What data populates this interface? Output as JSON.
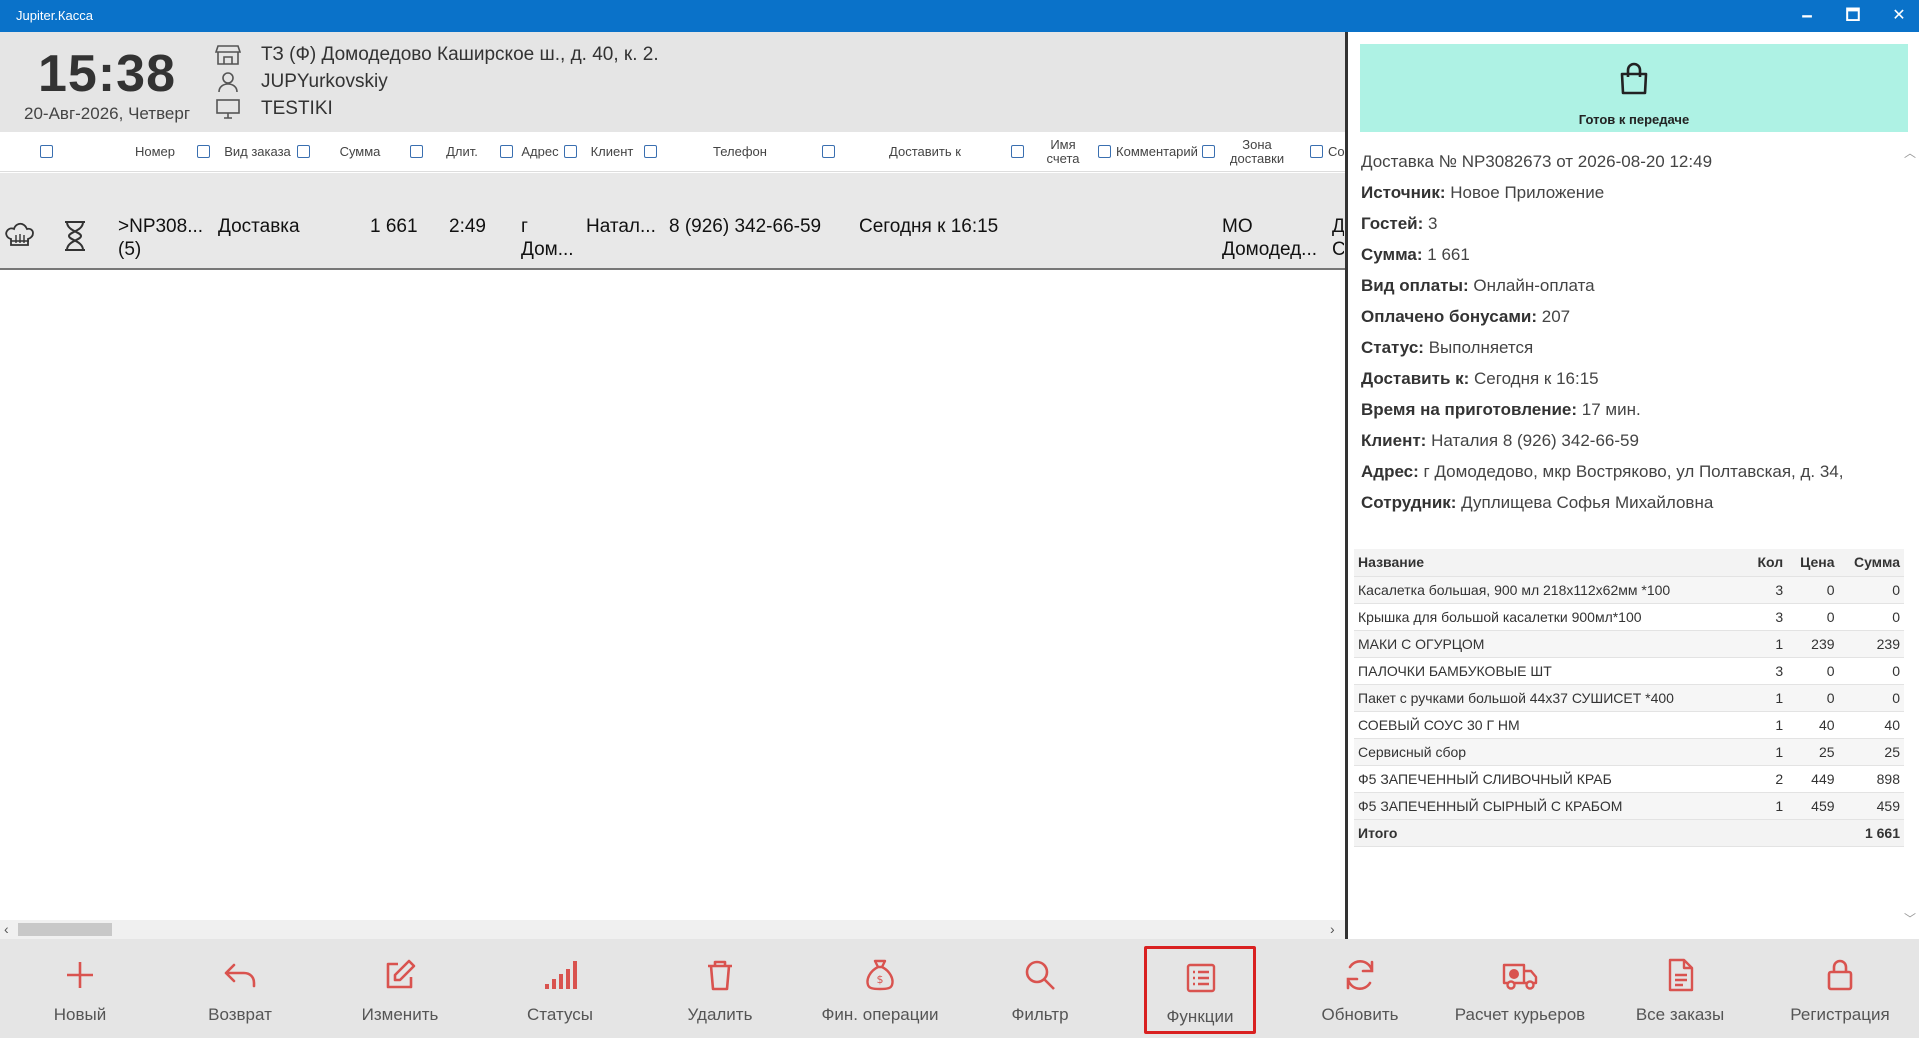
{
  "window": {
    "title": "Jupiter.Касса",
    "min": "🗕",
    "max": "🗖",
    "close": "✕"
  },
  "header": {
    "time": "15:38",
    "date": "20-Авг-2026, Четверг",
    "store": "ТЗ (Ф) Домодедово Каширское ш., д. 40, к. 2.",
    "user": "JUPYurkovskiy",
    "terminal": "TESTIKI"
  },
  "columns": [
    "Номер",
    "Вид заказа",
    "Сумма",
    "Длит.",
    "Адрес",
    "Клиент",
    "Телефон",
    "Доставить к",
    "Имя счета",
    "Комментарий",
    "Зона доставки",
    "Со"
  ],
  "orders": [
    {
      "number": ">NP308... (5)",
      "type": "Доставка",
      "sum": "1 661",
      "duration": "2:49",
      "address": "г Дом...",
      "client": "Натал...",
      "phone": "8 (926) 342-66-59",
      "deliver_by": "Сегодня к 16:15",
      "zone": "МО Домодед...",
      "extra": "Д С"
    }
  ],
  "detail": {
    "status_button": "Готов к передаче",
    "title": "Доставка № NP3082673 от 2026-08-20 12:49",
    "fields": [
      {
        "label": "Источник:",
        "value": "Новое Приложение"
      },
      {
        "label": "Гостей:",
        "value": "3"
      },
      {
        "label": "Сумма:",
        "value": "1 661"
      },
      {
        "label": "Вид оплаты:",
        "value": "Онлайн-оплата"
      },
      {
        "label": "Оплачено бонусами:",
        "value": "207"
      },
      {
        "label": "Статус:",
        "value": "Выполняется"
      },
      {
        "label": "Доставить к:",
        "value": "Сегодня к 16:15"
      },
      {
        "label": "Время на приготовление:",
        "value": "17 мин."
      },
      {
        "label": "Клиент:",
        "value": "Наталия 8 (926) 342-66-59"
      },
      {
        "label": "Адрес:",
        "value": "г Домодедово, мкр Востряково, ул Полтавская, д. 34,"
      },
      {
        "label": "Сотрудник:",
        "value": "Дуплищева Софья Михайловна"
      }
    ],
    "table_headers": [
      "Название",
      "Кол",
      "Цена",
      "Сумма"
    ],
    "items": [
      {
        "name": "Касалетка большая, 900 мл 218х112х62мм *100",
        "qty": "3",
        "price": "0",
        "sum": "0"
      },
      {
        "name": "Крышка для большой касалетки 900мл*100",
        "qty": "3",
        "price": "0",
        "sum": "0"
      },
      {
        "name": "МАКИ С ОГУРЦОМ",
        "qty": "1",
        "price": "239",
        "sum": "239"
      },
      {
        "name": "ПАЛОЧКИ БАМБУКОВЫЕ ШТ",
        "qty": "3",
        "price": "0",
        "sum": "0"
      },
      {
        "name": "Пакет с ручками большой 44х37 СУШИСЕТ *400",
        "qty": "1",
        "price": "0",
        "sum": "0"
      },
      {
        "name": "СОЕВЫЙ СОУС 30 Г НМ",
        "qty": "1",
        "price": "40",
        "sum": "40"
      },
      {
        "name": "Сервисный сбор",
        "qty": "1",
        "price": "25",
        "sum": "25"
      },
      {
        "name": "Ф5 ЗАПЕЧЕННЫЙ СЛИВОЧНЫЙ КРАБ",
        "qty": "2",
        "price": "449",
        "sum": "898"
      },
      {
        "name": "Ф5 ЗАПЕЧЕННЫЙ СЫРНЫЙ С КРАБОМ",
        "qty": "1",
        "price": "459",
        "sum": "459"
      }
    ],
    "total_label": "Итого",
    "total": "1 661"
  },
  "toolbar": [
    {
      "label": "Новый",
      "icon": "plus-icon"
    },
    {
      "label": "Возврат",
      "icon": "return-arrow-icon"
    },
    {
      "label": "Изменить",
      "icon": "edit-icon"
    },
    {
      "label": "Статусы",
      "icon": "bar-chart-icon"
    },
    {
      "label": "Удалить",
      "icon": "trash-icon"
    },
    {
      "label": "Фин. операции",
      "icon": "money-bag-icon"
    },
    {
      "label": "Фильтр",
      "icon": "search-icon"
    },
    {
      "label": "Функции",
      "icon": "list-icon",
      "selected": true
    },
    {
      "label": "Обновить",
      "icon": "refresh-icon"
    },
    {
      "label": "Расчет курьеров",
      "icon": "truck-icon"
    },
    {
      "label": "Все заказы",
      "icon": "document-icon"
    },
    {
      "label": "Регистрация",
      "icon": "lock-icon"
    }
  ],
  "colors": {
    "titlebar": "#0a72c9",
    "accent": "#d9534f",
    "ready_bg": "#aef2e4",
    "selected_border": "#d92020"
  }
}
